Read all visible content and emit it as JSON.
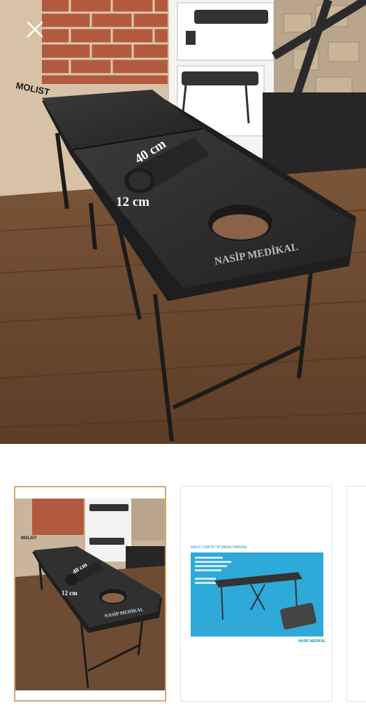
{
  "viewer": {
    "close_icon": "close-icon",
    "selected_index": 0,
    "accent_color": "#d9a66e"
  },
  "main_image": {
    "brand_sign": "MOLIST",
    "dimension_length": "40 cm",
    "dimension_height": "12 cm",
    "watermark": "NASİP MEDİKAL"
  },
  "thumbnails": [
    {
      "dimension_length": "40 cm",
      "dimension_height": "12 cm",
      "watermark": "NASİP MEDİKAL",
      "brand_sign": "MOLIST"
    },
    {
      "heading": "MAFIC CANTA TİP MASAJ MASASI",
      "brand": "NASİP MEDİKAL"
    },
    {}
  ]
}
